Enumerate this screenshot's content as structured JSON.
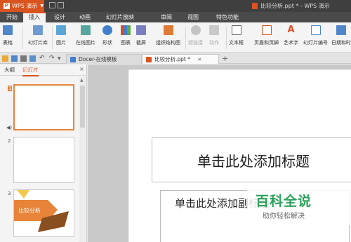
{
  "app": {
    "brand": "WPS 演示",
    "window_title": "比较分析.ppt * - WPS 演示"
  },
  "menu": [
    "开始",
    "插入",
    "设计",
    "动画",
    "幻灯片放映",
    "审阅",
    "视图",
    "特色功能"
  ],
  "menu_active": "插入",
  "ribbon": {
    "items": [
      "表格",
      "幻灯片库",
      "图片",
      "在线图片",
      "形状",
      "图表",
      "截屏",
      "组织结构图",
      "超链接",
      "动作",
      "文本框",
      "页眉和页脚",
      "艺术字",
      "幻灯片编号",
      "日期和时"
    ]
  },
  "tabs": [
    {
      "label": "Docer-在线模板",
      "active": false
    },
    {
      "label": "比较分析.ppt *",
      "active": true
    }
  ],
  "panel": {
    "tabs": [
      "大纲",
      "幻灯片"
    ],
    "active_tab": "幻灯片",
    "slides": [
      {
        "number": "1",
        "selected": true
      },
      {
        "number": "2",
        "selected": false
      },
      {
        "number": "3",
        "selected": false,
        "label": "比较分析"
      }
    ]
  },
  "slide": {
    "title_placeholder": "单击此处添加标题",
    "subtitle_placeholder": "单击此处添加副标题"
  },
  "watermark": {
    "brand": "百科全说",
    "slogan": "助你轻松解决"
  },
  "colors": {
    "accent": "#d9531e",
    "thumb_accent": "#e8833a",
    "watermark_green": "#2aa15a"
  }
}
